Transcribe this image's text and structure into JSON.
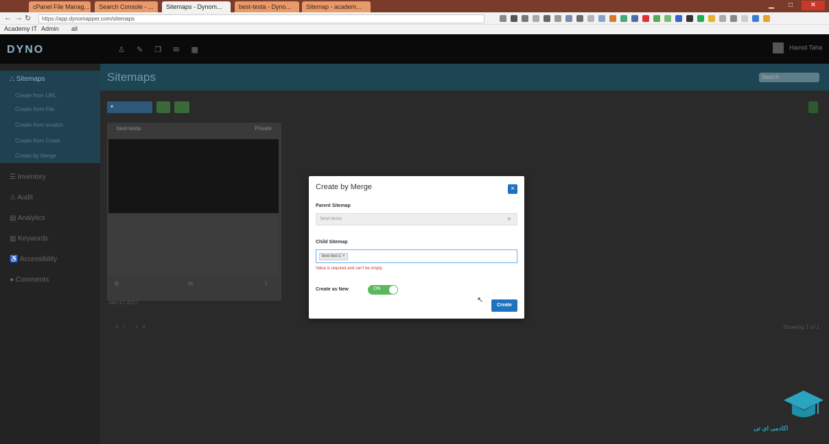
{
  "browser": {
    "tabs": [
      {
        "label": "cPanel File Manag..."
      },
      {
        "label": "Search Console - ..."
      },
      {
        "label": "Sitemaps - Dynom..."
      },
      {
        "label": "best-testa - Dyno..."
      },
      {
        "label": "Sitemap - academ..."
      }
    ],
    "url": "https://app.dynomapper.com/sitemaps",
    "bookmarks": [
      "Academy IT",
      "Admin",
      "all"
    ]
  },
  "app": {
    "logo": "DYNO",
    "user": "Hamid Taha"
  },
  "sidebar": {
    "items": [
      {
        "label": "Sitemaps"
      },
      {
        "label": "Inventory"
      },
      {
        "label": "Audit"
      },
      {
        "label": "Analytics"
      },
      {
        "label": "Keywords"
      },
      {
        "label": "Accessibility"
      },
      {
        "label": "Comments"
      }
    ],
    "subitems": [
      {
        "label": "Create from URL"
      },
      {
        "label": "Create from File"
      },
      {
        "label": "Create from scratch"
      },
      {
        "label": "Create from Crawl"
      },
      {
        "label": "Create by Merge"
      }
    ]
  },
  "main": {
    "title": "Sitemaps",
    "search_placeholder": "Search",
    "card_title": "best-testa",
    "card_private": "Private",
    "meta": "Jan 17 2017",
    "showing": "Showing 1 of 1"
  },
  "modal": {
    "title": "Create by Merge",
    "close": "×",
    "parent_label": "Parent Sitemap",
    "parent_value": "best-testa",
    "child_label": "Child Sitemap",
    "child_chip": "best-test-1 ×",
    "error": "Value is required and can't be empty",
    "create_new_label": "Create as New",
    "toggle_text": "ON",
    "create_button": "Create"
  },
  "watermark": {
    "text": "اکادمی ای تی"
  },
  "colors": {
    "accent": "#1e73be",
    "header": "#1e4554",
    "toggle": "#5cb85c"
  }
}
